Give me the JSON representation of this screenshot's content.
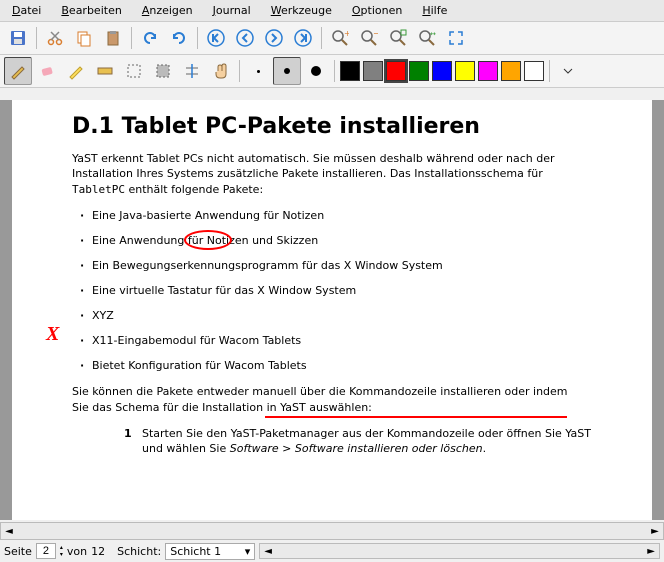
{
  "menubar": {
    "file": "Datei",
    "edit": "Bearbeiten",
    "view": "Anzeigen",
    "journal": "Journal",
    "tools": "Werkzeuge",
    "options": "Optionen",
    "help": "Hilfe"
  },
  "colors": {
    "palette": [
      "#000000",
      "#808080",
      "#ff0000",
      "#008000",
      "#0000ff",
      "#ffff00",
      "#ff00ff",
      "#ffa500",
      "#ffffff"
    ]
  },
  "document": {
    "heading": "D.1 Tablet PC-Pakete installieren",
    "intro_1": "YaST erkennt Tablet PCs nicht automatisch. Sie müssen deshalb während oder nach der Installation Ihres Systems zusätzliche Pakete installieren. Das Installationsschema für ",
    "intro_code": "TabletPC",
    "intro_2": " enthält folgende Pakete:",
    "bullets": [
      "Eine Java-basierte Anwendung für Notizen",
      "Eine Anwendung für Notizen und Skizzen",
      "Ein Bewegungserkennungsprogramm für das X Window System",
      "Eine virtuelle Tastatur für das X Window System",
      "XYZ",
      "X11-Eingabemodul für Wacom Tablets",
      "Bietet Konfiguration für Wacom Tablets"
    ],
    "para2_a": "Sie können die Pakete entweder manuell über die Kommandozeile installieren oder indem ",
    "para2_b": "Sie das Schema für die Installation in YaST auswählen:",
    "step1_a": "Starten Sie den YaST-Paketmanager aus der Kommandozeile oder öffnen Sie YaST und wählen Sie ",
    "step1_italic": "Software > Software installieren oder löschen",
    "step1_b": "."
  },
  "status": {
    "page_label": "Seite",
    "page_value": "2",
    "of_label": "von",
    "total_pages": "12",
    "layer_label": "Schicht:",
    "layer_value": "Schicht 1"
  }
}
